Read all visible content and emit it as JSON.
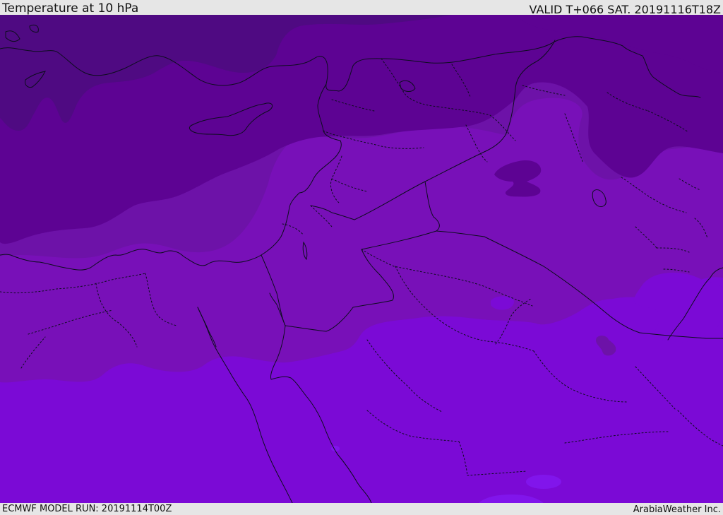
{
  "header": {
    "title": "Temperature at 10 hPa",
    "valid": "VALID T+066 SAT. 20191116T18Z"
  },
  "footer": {
    "model_run": "ECMWF MODEL RUN: 20191114T00Z",
    "credit": "ArabiaWeather Inc."
  },
  "map": {
    "colors": {
      "coldest": "#4f0a82",
      "very_cold": "#5d0393",
      "cold": "#6d12a8",
      "cool": "#7810b8",
      "warm": "#7b0ad6",
      "warmest": "#8115eb",
      "line": "#0c0d1d"
    }
  }
}
